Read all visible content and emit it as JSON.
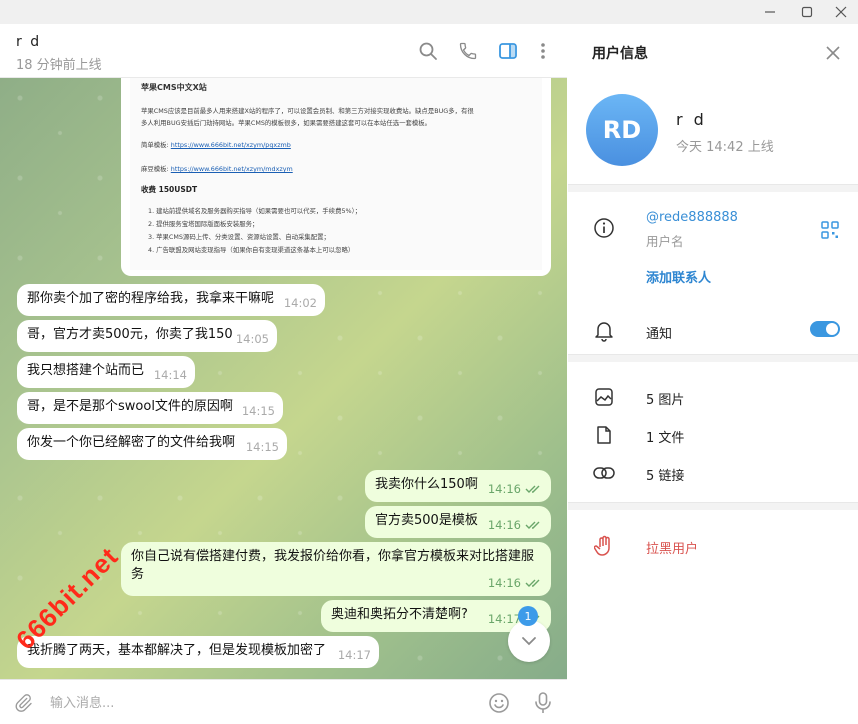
{
  "window": {
    "minimize_icon": "minimize-icon",
    "maximize_icon": "maximize-icon",
    "close_icon": "close-icon"
  },
  "chat_header": {
    "name": "r d",
    "status": "18 分钟前上线"
  },
  "image_message": {
    "title": "苹果CMS中文X站",
    "intro_1": "苹果CMS应该是目前最多人用来搭建X站的程序了，可以设置会员制、和第三方对接实现收费站。缺点是BUG多，有很",
    "intro_2": "多人利用BUG安插后门劫持网站。苹果CMS的模板很多，如果需要搭建这套可以在本站任选一套模板。",
    "simple_label": "简单模板:",
    "simple_url": "https://www.666bit.net/xzym/pgxzmb",
    "madou_label": "麻豆模板:",
    "madou_url": "https://www.666bit.net/xzym/mdxzym",
    "price": "收费 150USDT",
    "items": [
      "1. 建站前提供域名及服务器购买指导（如果需要也可以代买，手续费5%）；",
      "2. 提供服务宝塔国际版面板安装服务；",
      "3. 苹果CMS源码上传、分类设置、资源站设置、自动采集配置；",
      "4. 广告联盟及网站变现指导（如果你自有变现渠道这条基本上可以忽略）"
    ]
  },
  "messages": [
    {
      "text": "那你卖个加了密的程序给我，我拿来干嘛呢",
      "time": "14:02",
      "dir": "in"
    },
    {
      "text": "哥，官方才卖500元，你卖了我150",
      "time": "14:05",
      "dir": "in"
    },
    {
      "text": "我只想搭建个站而已",
      "time": "14:14",
      "dir": "in"
    },
    {
      "text": "哥，是不是那个swool文件的原因啊",
      "time": "14:15",
      "dir": "in"
    },
    {
      "text": "你发一个你已经解密了的文件给我啊",
      "time": "14:15",
      "dir": "in"
    },
    {
      "text": "我卖你什么150啊",
      "time": "14:16",
      "dir": "out"
    },
    {
      "text": "官方卖500是模板",
      "time": "14:16",
      "dir": "out"
    },
    {
      "text": "你自己说有偿搭建付费，我发报价给你看，你拿官方模板来对比搭建服务",
      "time": "14:16",
      "dir": "out"
    },
    {
      "text": "奥迪和奥拓分不清楚啊?",
      "time": "14:17",
      "dir": "out"
    },
    {
      "text": "我折腾了两天，基本都解决了，但是发现模板加密了",
      "time": "14:17",
      "dir": "in"
    }
  ],
  "unread_badge": "1",
  "watermark": "666bit.net",
  "composer": {
    "placeholder": "输入消息..."
  },
  "info_panel": {
    "title": "用户信息",
    "avatar_initials": "RD",
    "name": "r d",
    "status": "今天 14:42 上线",
    "username": "@rede888888",
    "username_label": "用户名",
    "add_contact": "添加联系人",
    "notifications": "通知",
    "notifications_on": true,
    "photos": "5 图片",
    "files": "1 文件",
    "links": "5 链接",
    "block": "拉黑用户"
  },
  "colors": {
    "accent": "#3a97e0",
    "danger": "#d9534f",
    "outgoing_bubble": "#effedd",
    "check": "#6aa66a"
  }
}
